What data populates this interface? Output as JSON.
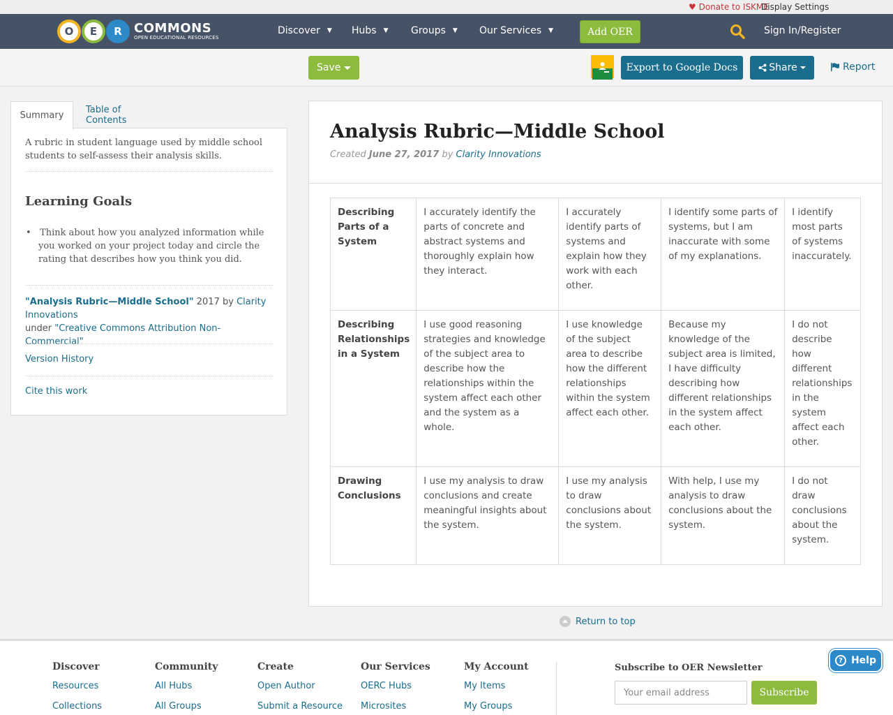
{
  "utility": {
    "donate": "Donate to ISKME",
    "display_settings": "Display Settings"
  },
  "logo": {
    "letters": [
      "O",
      "E",
      "R"
    ],
    "wordmark": "COMMONS",
    "tagline": "OPEN EDUCATIONAL RESOURCES"
  },
  "nav": {
    "items": [
      {
        "label": "Discover"
      },
      {
        "label": "Hubs"
      },
      {
        "label": "Groups"
      },
      {
        "label": "Our Services"
      }
    ],
    "add_oer": "Add OER",
    "sign_in": "Sign In/Register",
    "icons": {
      "search": "search-icon",
      "chevron": "chevron-down-icon"
    }
  },
  "toolbar": {
    "save": "Save",
    "export": "Export to Google Docs",
    "share": "Share",
    "report": "Report",
    "icons": {
      "classroom": "google-classroom-icon",
      "share": "share-icon",
      "report": "flag-icon"
    }
  },
  "sidebar": {
    "tabs": [
      "Summary",
      "Table of Contents"
    ],
    "summary": "A rubric in student language used by middle school students to self-assess their analysis skills.",
    "learning_goals_title": "Learning Goals",
    "learning_goals": [
      "Think about how you analyzed information while you worked on your project today and circle the rating that describes how you think you did."
    ],
    "attribution": {
      "title": "\"Analysis Rubric—Middle School\"",
      "year_by": " 2017 by ",
      "author": "Clarity Innovations",
      "under": "under ",
      "license": "\"Creative Commons Attribution Non-Commercial\""
    },
    "version_history": "Version History",
    "cite": "Cite this work"
  },
  "main": {
    "title": "Analysis Rubric—Middle School",
    "created_label": "Created ",
    "created_date": "June 27, 2017",
    "by_label": " by ",
    "author": "Clarity Innovations",
    "rubric": [
      {
        "criterion": "Describing Parts of a System",
        "levels": [
          "I accurately identify the parts of concrete and abstract systems and thoroughly explain how they interact.",
          "I accurately identify parts of systems and explain how they work with each other.",
          "I identify some parts of systems, but I am inaccurate with some of my explanations.",
          "I identify most parts of systems inaccurately."
        ]
      },
      {
        "criterion": "Describing Relationships in a System",
        "levels": [
          "I use good reasoning strategies and knowledge of the subject area to describe how the relationships within the system affect each other and the system as a whole.",
          "I use knowledge of the subject area to describe how the different relationships within the system affect each other.",
          "Because my knowledge of the subject area is limited, I have difficulty describing how different relationships in the system affect each other.",
          "I do not describe how different relationships in the system affect each other."
        ]
      },
      {
        "criterion": "Drawing Conclusions",
        "levels": [
          "I use my analysis to draw conclusions and create meaningful insights about the system.",
          "I use my analysis to draw conclusions about the system.",
          "With help, I use my analysis to draw conclusions about the system.",
          "I do not draw conclusions about the system."
        ]
      }
    ],
    "return_top": "Return to top"
  },
  "footer": {
    "columns": [
      {
        "heading": "Discover",
        "links": [
          "Resources",
          "Collections"
        ]
      },
      {
        "heading": "Community",
        "links": [
          "All Hubs",
          "All Groups"
        ]
      },
      {
        "heading": "Create",
        "links": [
          "Open Author",
          "Submit a Resource"
        ]
      },
      {
        "heading": "Our Services",
        "links": [
          "OERC Hubs",
          "Microsites"
        ]
      },
      {
        "heading": "My Account",
        "links": [
          "My Items",
          "My Groups"
        ]
      }
    ],
    "newsletter_title": "Subscribe to OER Newsletter",
    "email_placeholder": "Your email address",
    "subscribe": "Subscribe"
  },
  "help": "Help",
  "colors": {
    "nav_bg": "#465366",
    "accent_green": "#8dbb3d",
    "link_blue": "#1a6d8c",
    "donate_red": "#c8343c",
    "help_blue": "#2e89c8"
  }
}
